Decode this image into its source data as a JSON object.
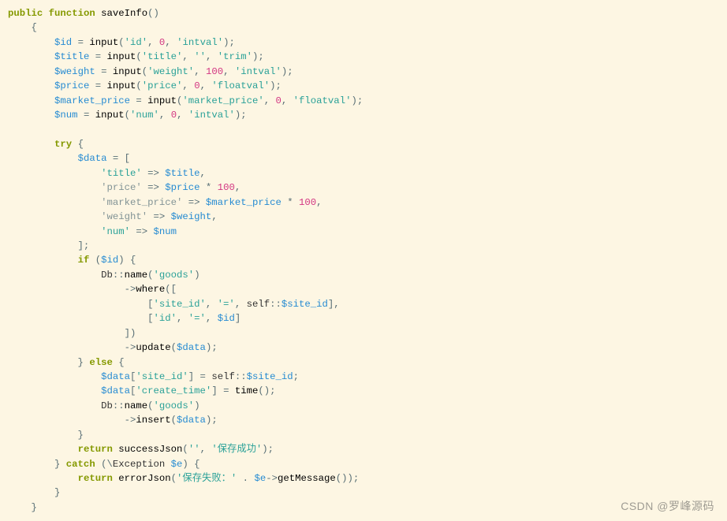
{
  "kw": {
    "public": "public",
    "function": "function",
    "try": "try",
    "catch": "catch",
    "if": "if",
    "else": "else",
    "return": "return"
  },
  "fn": {
    "saveInfo": "saveInfo",
    "input": "input",
    "name": "name",
    "where": "where",
    "update": "update",
    "insert": "insert",
    "time": "time",
    "successJson": "successJson",
    "errorJson": "errorJson",
    "getMessage": "getMessage"
  },
  "cls": {
    "Db": "Db",
    "Exception": "Exception",
    "self": "self"
  },
  "var": {
    "id": "$id",
    "title": "$title",
    "weight": "$weight",
    "price": "$price",
    "market_price": "$market_price",
    "num": "$num",
    "data": "$data",
    "site_id": "$site_id",
    "e": "$e"
  },
  "str": {
    "id": "'id'",
    "title": "'title'",
    "weight": "'weight'",
    "price": "'price'",
    "market_price": "'market_price'",
    "num": "'num'",
    "intval": "'intval'",
    "trim": "'trim'",
    "floatval": "'floatval'",
    "empty": "''",
    "goods": "'goods'",
    "site_id": "'site_id'",
    "eq": "'='",
    "create_time": "'create_time'",
    "save_ok": "'保存成功'",
    "save_fail": "'保存失败：'"
  },
  "num": {
    "n0": "0",
    "n100": "100"
  },
  "watermark": "CSDN @罗峰源码"
}
